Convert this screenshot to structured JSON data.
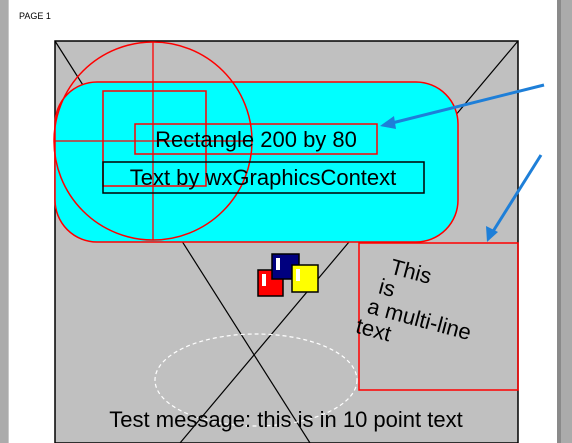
{
  "page": {
    "label": "PAGE 1"
  },
  "drawing": {
    "rectangle_label": "Rectangle 200 by 80",
    "graphics_text": "Text by wxGraphicsContext",
    "multiline_text": [
      "This",
      "is",
      "a multi-line",
      "text"
    ],
    "test_message": "Test message: this is in 10 point text"
  },
  "colors": {
    "page_background": "#ffffff",
    "drawing_background": "#c0c0c0",
    "rounded_rect_fill": "#00ffff",
    "outline_red": "#ff0000",
    "arrow_blue": "#1e7fd8",
    "square_red": "#ff0000",
    "square_navy": "#00007f",
    "square_yellow": "#ffff00"
  }
}
